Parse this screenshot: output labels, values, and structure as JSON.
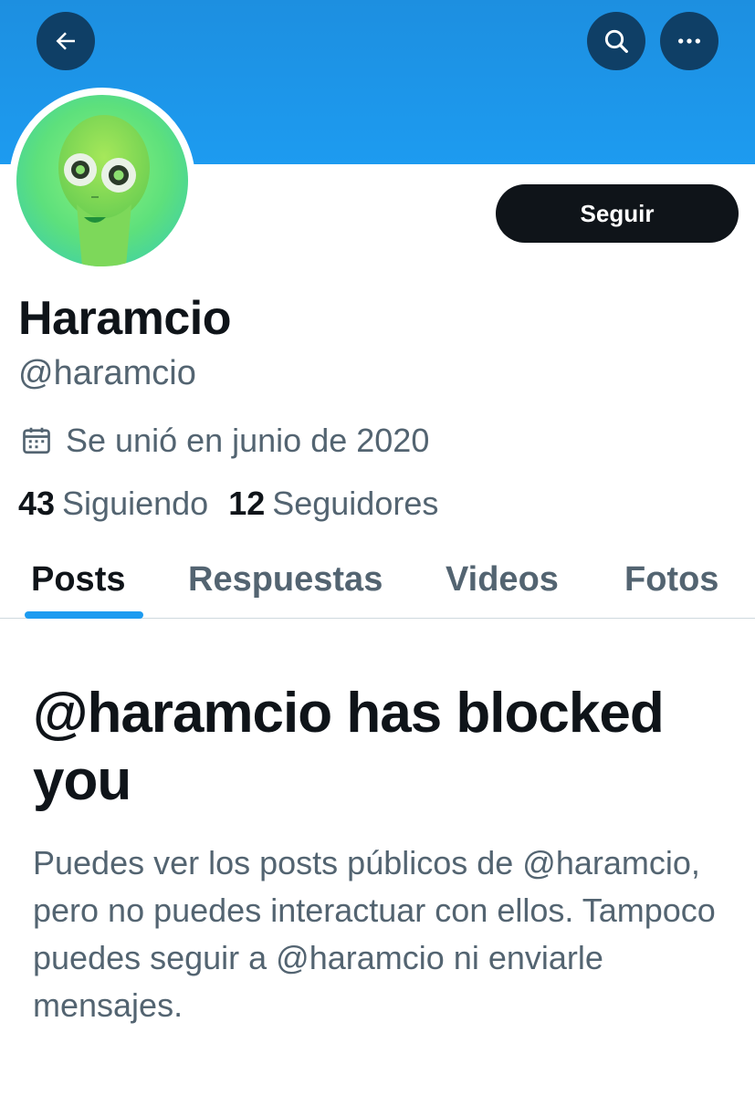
{
  "topbar": {
    "back_icon": "arrow-left-icon",
    "search_icon": "search-icon",
    "more_icon": "more-horizontal-icon",
    "banner_color": "#1d9bf0",
    "button_color": "#0f3f66"
  },
  "profile": {
    "display_name": "Haramcio",
    "handle": "@haramcio",
    "joined": "Se unió en junio de 2020",
    "joined_icon": "calendar-icon",
    "follow_label": "Seguir"
  },
  "stats": {
    "following_count": "43",
    "following_label": "Siguiendo",
    "followers_count": "12",
    "followers_label": "Seguidores"
  },
  "tabs": [
    {
      "label": "Posts",
      "active": true
    },
    {
      "label": "Respuestas",
      "active": false
    },
    {
      "label": "Videos",
      "active": false
    },
    {
      "label": "Fotos",
      "active": false
    }
  ],
  "blocked": {
    "title": "@haramcio has blocked you",
    "description": "Puedes ver los posts públicos de @haramcio, pero no puedes interactuar con ellos. Tampoco puedes seguir a @haramcio ni enviarle mensajes."
  },
  "colors": {
    "accent": "#1d9bf0",
    "text_primary": "#0f1419",
    "text_secondary": "#536471"
  }
}
